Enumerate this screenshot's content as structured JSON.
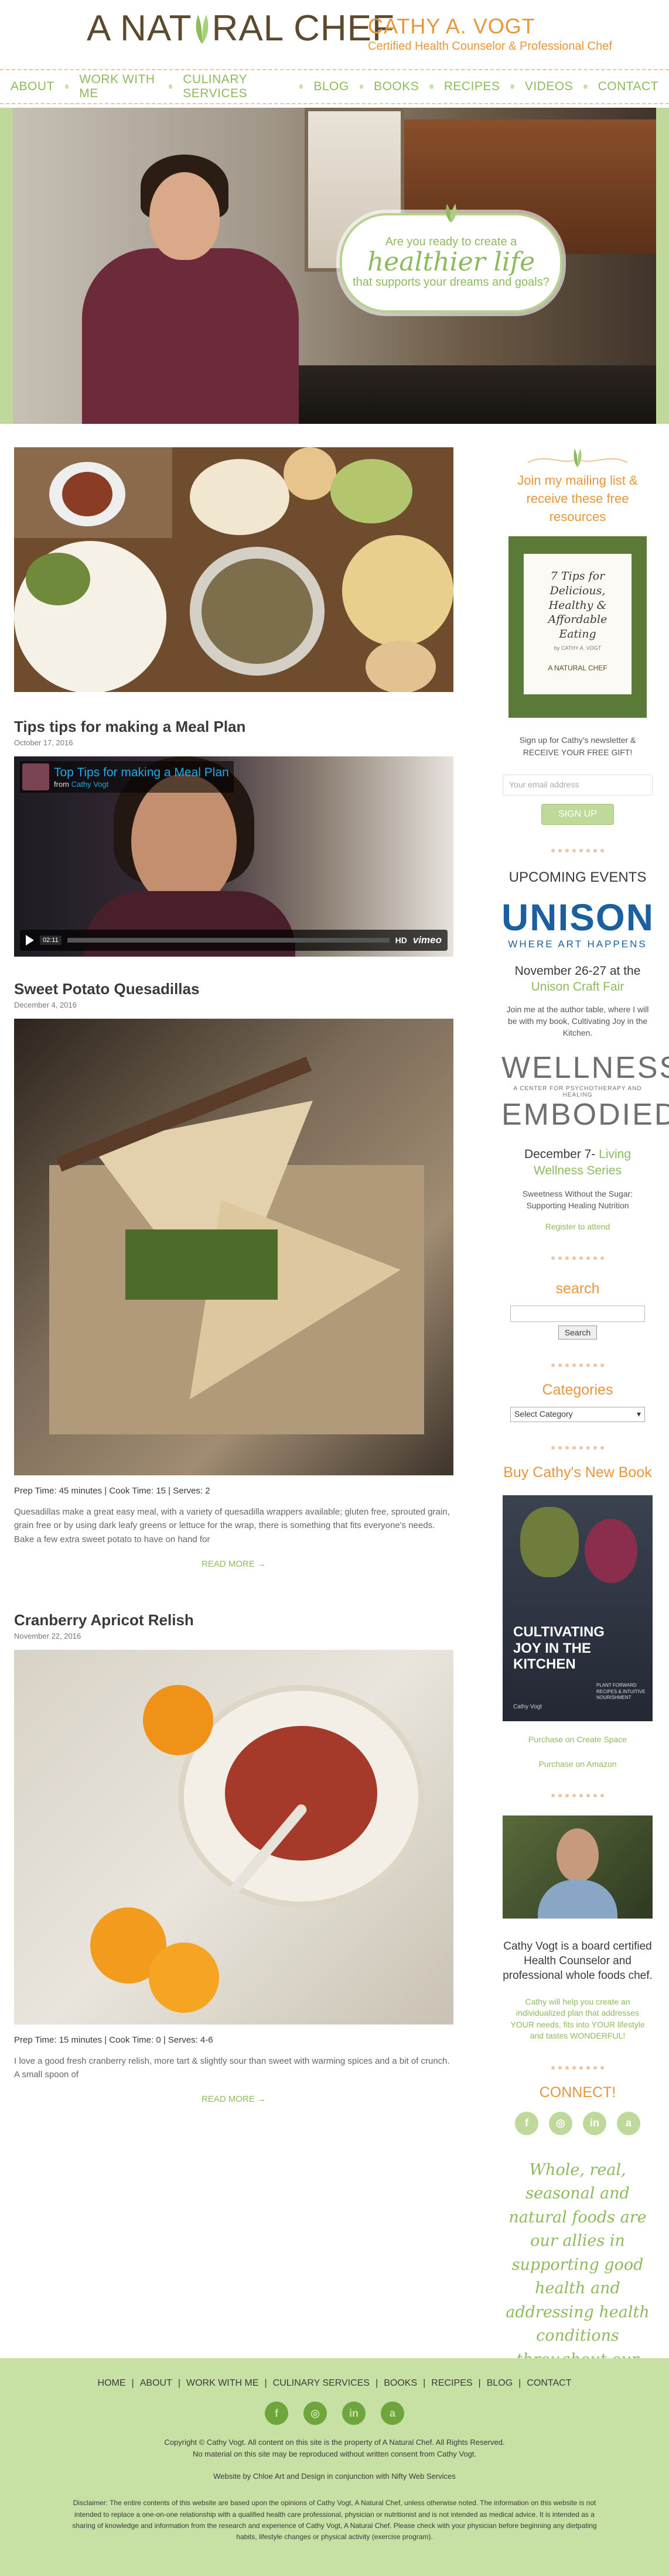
{
  "header": {
    "logo_text_left": "A NAT",
    "logo_text_right": "RAL CHEF",
    "name": "CATHY A. VOGT",
    "subtitle": "Certified Health Counselor & Professional Chef"
  },
  "nav": {
    "items": [
      "ABOUT",
      "WORK WITH ME",
      "CULINARY SERVICES",
      "BLOG",
      "BOOKS",
      "RECIPES",
      "VIDEOS",
      "CONTACT"
    ]
  },
  "hero": {
    "line1": "Are you ready to create a",
    "line2": "healthier life",
    "line3": "that supports your dreams and goals?"
  },
  "posts": [
    {
      "title": "Tips tips for making a Meal Plan",
      "date": "October 17, 2016",
      "video": {
        "title": "Top Tips for making a Meal Plan",
        "from_prefix": "from",
        "from_author": "Cathy Vogt",
        "time": "02:11",
        "hd": "HD",
        "brand": "vimeo"
      }
    },
    {
      "title": "Sweet Potato Quesadillas",
      "date": "December 4, 2016",
      "meta": "Prep Time:  45 minutes | Cook Time: 15 | Serves: 2",
      "excerpt": "Quesadillas make a great easy meal, with a variety of quesadilla wrappers available; gluten free, sprouted grain, grain free or by using dark leafy greens or lettuce for the wrap, there is something that fits everyone's needs.  Bake a few extra sweet potato to have on hand for",
      "read_more": "READ MORE →"
    },
    {
      "title": "Cranberry Apricot Relish",
      "date": "November 22, 2016",
      "meta": "Prep Time:  15 minutes | Cook Time: 0 | Serves: 4-6",
      "excerpt": "I love a good fresh cranberry relish, more tart & slightly sour than sweet with warming spices and a bit of crunch.  A small spoon of",
      "read_more": "READ MORE →"
    }
  ],
  "sidebar": {
    "mailing_heading": "Join my mailing list & receive these free resources",
    "book_cover_title": "7 Tips for Delicious, Healthy & Affordable Eating",
    "book_cover_by": "by CATHY A. VOGT",
    "book_cover_brand": "A NATURAL CHEF",
    "signup_text": "Sign up for Cathy's newsletter & RECEIVE YOUR FREE GIFT!",
    "email_placeholder": "Your email address",
    "signup_button": "SIGN UP",
    "events_title": "UPCOMING EVENTS",
    "unison_logo": "UNISON",
    "unison_tag": "WHERE ART HAPPENS",
    "event1_date": "November 26-27 at the",
    "event1_name": "Unison Craft Fair",
    "event1_text": "Join me at the author table, where I will be with my book, Cultivating Joy in the Kitchen.",
    "wellness_logo": "WELLNESS",
    "wellness_tag": "A CENTER FOR PSYCHOTHERAPY AND HEALING",
    "wellness_logo2": "EMBODIED",
    "event2_date": "December 7- ",
    "event2_name": "Living Wellness Series",
    "event2_text": "Sweetness Without the Sugar: Supporting Healing Nutrition",
    "register": "Register to attend",
    "search_title": "search",
    "search_button": "Search",
    "categories_title": "Categories",
    "category_select": "Select Category",
    "book_title": "Buy Cathy's New Book",
    "book_cover_text": "CULTIVATING JOY IN THE KITCHEN",
    "book_cover_sub": "PLANT FORWARD RECIPES & INTUITIVE NOURISHMENT",
    "book_cover_author": "Cathy Vogt",
    "purchase1": "Purchase on Create Space",
    "purchase2": "Purchase on Amazon",
    "bio": "Cathy Vogt is a board certified Health Counselor and professional whole foods chef.",
    "bio_green": "Cathy will help you create an individualized plan that addresses YOUR needs, fits into YOUR lifestyle and tastes WONDERFUL!",
    "connect_title": "CONNECT!",
    "quote": "Whole, real, seasonal and natural foods are our allies in supporting good health and addressing health conditions throughout our lifetime."
  },
  "footer": {
    "nav": [
      "HOME",
      "ABOUT",
      "WORK WITH ME",
      "CULINARY SERVICES",
      "BOOKS",
      "RECIPES",
      "BLOG",
      "CONTACT"
    ],
    "copyright": "Copyright © Cathy Vogt. All content on this site is the property of A Natural Chef. All Rights Reserved.",
    "no_material": "No material on this site may be reproduced without written consent from Cathy Vogt.",
    "credit": "Website by Chloe Art and Design in conjunction with Nifty Web Services",
    "disclaimer": "Disclaimer: The entire contents of this website are based upon the opinions of Cathy Vogt, A Natural Chef, unless otherwise noted. The information on this website is not intended to replace a one-on-one relationship with a qualified health care professional, physician or nutritionist and is not intended as medical advice. It is intended as a sharing of knowledge and information from the research and experience of Cathy Vogt, A Natural Chef. Please check with your physician before beginning any dietpating habits, lifestyle changes or physical activity (exercise program)."
  },
  "colors": {
    "green": "#8dbb5c",
    "orange": "#e8963a",
    "footer_bg": "#c7e1a5"
  },
  "icons": [
    "leaf-icon",
    "facebook-icon",
    "instagram-icon",
    "linkedin-icon",
    "amazon-icon",
    "play-icon"
  ]
}
